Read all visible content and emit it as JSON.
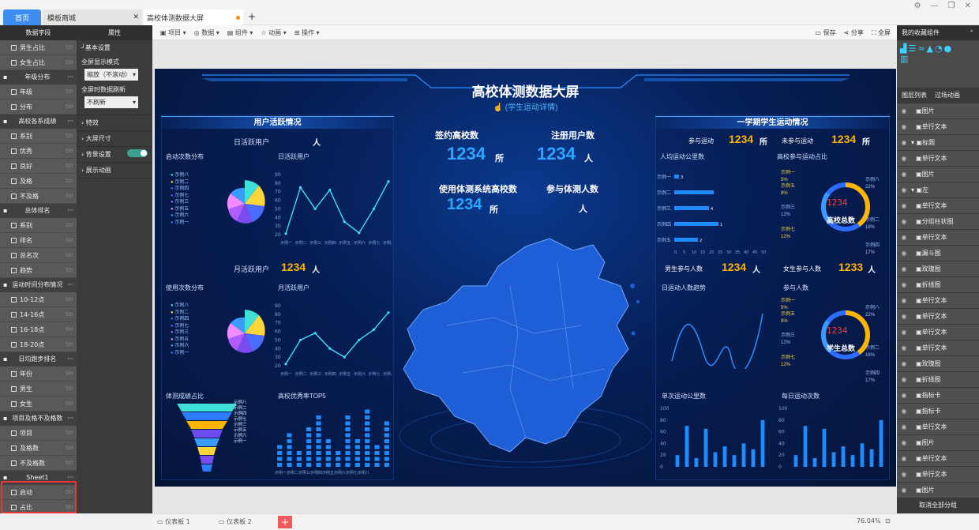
{
  "tabs": {
    "home": "首页",
    "template": "模板商城",
    "current": "高校体测数据大屏",
    "add": "+"
  },
  "window": {
    "settings": "⚙",
    "min": "—",
    "restore": "❐",
    "close": "✕"
  },
  "left_panel": {
    "title": "数据字段",
    "groups": [
      {
        "name": "",
        "items": [
          "男生占比",
          "女生占比"
        ]
      },
      {
        "name": "年级分布",
        "items": [
          "年级",
          "分布"
        ]
      },
      {
        "name": "高校各系成绩",
        "items": [
          "系别",
          "优秀",
          "良好",
          "及格",
          "不及格"
        ]
      },
      {
        "name": "总体排名",
        "items": [
          "系别",
          "排名",
          "总名次",
          "趋势"
        ]
      },
      {
        "name": "运动时间分布情况",
        "items": [
          "10-12点",
          "14-16点",
          "16-18点",
          "18-20点"
        ]
      },
      {
        "name": "日均跑步排名",
        "items": [
          "年份",
          "男生",
          "女生"
        ]
      },
      {
        "name": "项目及格不及格数",
        "items": [
          "项目",
          "及格数",
          "不及格数"
        ]
      },
      {
        "name": "Sheet1",
        "items": [
          "启动",
          "占比"
        ]
      }
    ]
  },
  "prop_panel": {
    "title": "属性",
    "basic": "基本设置",
    "fullscreen_mode": "全屏显示模式",
    "fullscreen_value": "缩放（不滚动）",
    "refresh": "全屏时数据刷新",
    "refresh_value": "不刷新",
    "effects": "特效",
    "size": "大屏尺寸",
    "bg": "背景设置",
    "anim": "展示动画"
  },
  "toolbar": {
    "project": "项目",
    "data": "数据",
    "component": "组件",
    "animation": "动画",
    "operate": "操作",
    "save": "保存",
    "share": "分享",
    "fullscreen": "全屏"
  },
  "dashboard": {
    "title": "高校体测数据大屏",
    "subtitle": "(学生运动详情)",
    "left_title": "用户活跃情况",
    "right_title": "一学期学生运动情况",
    "daily_active": "日活跃用户",
    "daily_unit": "人",
    "start_dist": "启动次数分布",
    "daily_chart": "日活跃用户",
    "monthly_active": "月活跃用户",
    "monthly_value": "1234",
    "monthly_unit": "人",
    "use_dist": "使用次数分布",
    "monthly_chart": "月活跃用户",
    "fitness": "体测成绩占比",
    "top5": "高校优秀率TOP5",
    "signed": "签约高校数",
    "signed_value": "1234",
    "signed_unit": "所",
    "registered": "注册用户数",
    "registered_value": "1234",
    "registered_unit": "人",
    "using": "使用体测系统高校数",
    "using_value": "1234",
    "using_unit": "所",
    "joined": "参与体测人数",
    "joined_unit": "人",
    "sport": "参与运动",
    "sport_value": "1234",
    "sport_unit": "所",
    "nosport": "未参与运动",
    "nosport_value": "1234",
    "nosport_unit": "所",
    "avg_km": "人均运动公里数",
    "ratio": "高校参与运动占比",
    "school_total": "高校总数",
    "lcd": "1234",
    "male": "男生参与人数",
    "male_value": "1234",
    "male_unit": "人",
    "female": "女生参与人数",
    "female_value": "1233",
    "female_unit": "人",
    "daily_trend": "日运动人数趋势",
    "join_count": "参与人数",
    "student_total": "学生总数",
    "single_km": "单次运动公里数",
    "daily_times": "每日运动次数",
    "legend8": [
      "示例八",
      "示例二",
      "示例四",
      "示例七",
      "示例三",
      "示例五",
      "示例六",
      "示例一"
    ],
    "hbar_labels": [
      "示例一",
      "示例二",
      "示例三",
      "示例四",
      "示例五"
    ],
    "hbar_values": [
      "3",
      "",
      "4",
      "1",
      "2"
    ],
    "hbar_ticks": [
      "0",
      "5",
      "10",
      "15",
      "20",
      "25",
      "30",
      "35",
      "40",
      "45",
      "50"
    ],
    "donut_labels": [
      "示例一",
      "5%",
      "示例五",
      "8%",
      "示例三",
      "12%",
      "示例七",
      "12%",
      "示例八",
      "22%",
      "示例二",
      "18%",
      "示例四",
      "17%"
    ],
    "xcats": "示例一示例二示例三示例四示例五示例六示例七示例八"
  },
  "chart_data": [
    {
      "type": "line",
      "title": "日活跃用户",
      "ylim": [
        20,
        90
      ],
      "yticks": [
        20,
        30,
        40,
        50,
        60,
        70,
        80,
        90
      ],
      "categories": [
        "示例一",
        "示例二",
        "示例三",
        "示例四",
        "示例五",
        "示例六",
        "示例七",
        "示例八"
      ],
      "values": [
        21,
        75,
        50,
        72,
        35,
        22,
        50,
        82
      ]
    },
    {
      "type": "line",
      "title": "月活跃用户",
      "ylim": [
        20,
        90
      ],
      "yticks": [
        20,
        30,
        40,
        50,
        60,
        70,
        80,
        90
      ],
      "categories": [
        "示例一",
        "示例二",
        "示例三",
        "示例四",
        "示例五",
        "示例六",
        "示例七",
        "示例八"
      ],
      "values": [
        22,
        50,
        58,
        40,
        30,
        50,
        62,
        82
      ]
    },
    {
      "type": "bar",
      "title": "单次运动公里数",
      "ylim": [
        0,
        100
      ],
      "yticks": [
        0,
        20,
        40,
        60,
        80,
        100
      ],
      "values": [
        20,
        70,
        15,
        65,
        25,
        35,
        20,
        40,
        30,
        80
      ]
    },
    {
      "type": "bar",
      "title": "每日运动次数",
      "ylim": [
        0,
        100
      ],
      "yticks": [
        0,
        20,
        40,
        60,
        80,
        100
      ],
      "values": [
        20,
        70,
        15,
        65,
        25,
        35,
        20,
        40,
        30,
        80
      ]
    },
    {
      "type": "bar",
      "title": "高校优秀率TOP5",
      "values": [
        4,
        6,
        3,
        7,
        9,
        5,
        3,
        9,
        5,
        10,
        4,
        8
      ]
    }
  ],
  "right_panel": {
    "title": "我的收藏组件",
    "tab_layers": "图层列表",
    "tab_trans": "过场动画",
    "layers": [
      "图片",
      "单行文本",
      "标题",
      "单行文本",
      "图片",
      "左",
      "单行文本",
      "分组柱状图",
      "单行文本",
      "漏斗图",
      "玫瑰图",
      "折线图",
      "单行文本",
      "单行文本",
      "单行文本",
      "单行文本",
      "玫瑰图",
      "折线图",
      "指标卡",
      "指标卡",
      "单行文本",
      "图片",
      "单行文本",
      "单行文本",
      "图片"
    ],
    "cancel": "取消全部分组"
  },
  "bottom": {
    "tab1": "仪表板 1",
    "tab2": "仪表板 2",
    "add": "+",
    "zoom": "76.04%"
  }
}
